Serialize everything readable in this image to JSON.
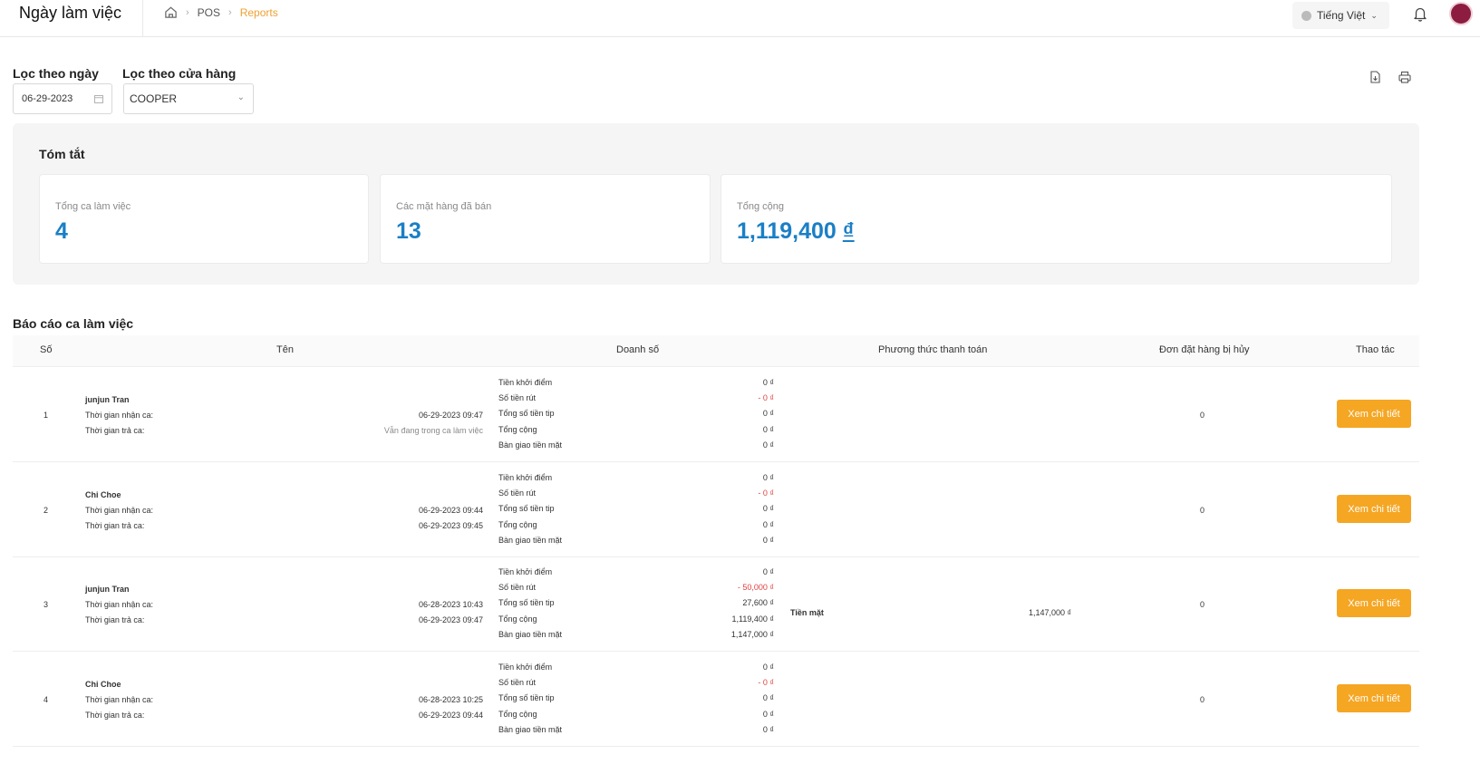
{
  "header": {
    "title": "Ngày làm việc",
    "breadcrumb": [
      "POS",
      "Reports"
    ],
    "language": "Tiếng Việt"
  },
  "filters": {
    "date_label": "Lọc theo ngày",
    "date_value": "06-29-2023",
    "store_label": "Lọc theo cửa hàng",
    "store_value": "COOPER"
  },
  "summary": {
    "title": "Tóm tắt",
    "cards": [
      {
        "label": "Tổng ca làm việc",
        "value": "4"
      },
      {
        "label": "Các mặt hàng đã bán",
        "value": "13"
      },
      {
        "label": "Tổng cộng",
        "value": "1,119,400",
        "currency": "₫"
      }
    ]
  },
  "report": {
    "title": "Báo cáo ca làm việc",
    "columns": [
      "Số",
      "Tên",
      "Doanh số",
      "Phương thức thanh toán",
      "Đơn đặt hàng bị hủy",
      "Thao tác"
    ],
    "revenue_labels": [
      "Tiền khởi điểm",
      "Số tiền rút",
      "Tổng số tiền tip",
      "Tổng cộng",
      "Bàn giao tiền mặt"
    ],
    "shift_start_label": "Thời gian nhận ca:",
    "shift_end_label": "Thời gian trả ca:",
    "action_label": "Xem chi tiết",
    "rows": [
      {
        "num": "1",
        "name": "junjun Tran",
        "start": "06-29-2023 09:47",
        "end": "Vẫn đang trong ca làm việc",
        "revenue": [
          "0 ₫",
          "- 0 ₫",
          "0 ₫",
          "0 ₫",
          "0 ₫"
        ],
        "pay_method": "",
        "pay_value": "",
        "cancelled": "0"
      },
      {
        "num": "2",
        "name": "Chi Choe",
        "start": "06-29-2023 09:44",
        "end": "06-29-2023 09:45",
        "revenue": [
          "0 ₫",
          "- 0 ₫",
          "0 ₫",
          "0 ₫",
          "0 ₫"
        ],
        "pay_method": "",
        "pay_value": "",
        "cancelled": "0"
      },
      {
        "num": "3",
        "name": "junjun Tran",
        "start": "06-28-2023 10:43",
        "end": "06-29-2023 09:47",
        "revenue": [
          "0 ₫",
          "- 50,000 ₫",
          "27,600 ₫",
          "1,119,400 ₫",
          "1,147,000 ₫"
        ],
        "pay_method": "Tiền mặt",
        "pay_value": "1,147,000 ₫",
        "cancelled": "0"
      },
      {
        "num": "4",
        "name": "Chi Choe",
        "start": "06-28-2023 10:25",
        "end": "06-29-2023 09:44",
        "revenue": [
          "0 ₫",
          "- 0 ₫",
          "0 ₫",
          "0 ₫",
          "0 ₫"
        ],
        "pay_method": "",
        "pay_value": "",
        "cancelled": "0"
      }
    ]
  },
  "colors": {
    "accent": "#f5a623",
    "value_blue": "#1a7fc6",
    "negative": "#e04040",
    "avatar": "#8c1d40"
  }
}
